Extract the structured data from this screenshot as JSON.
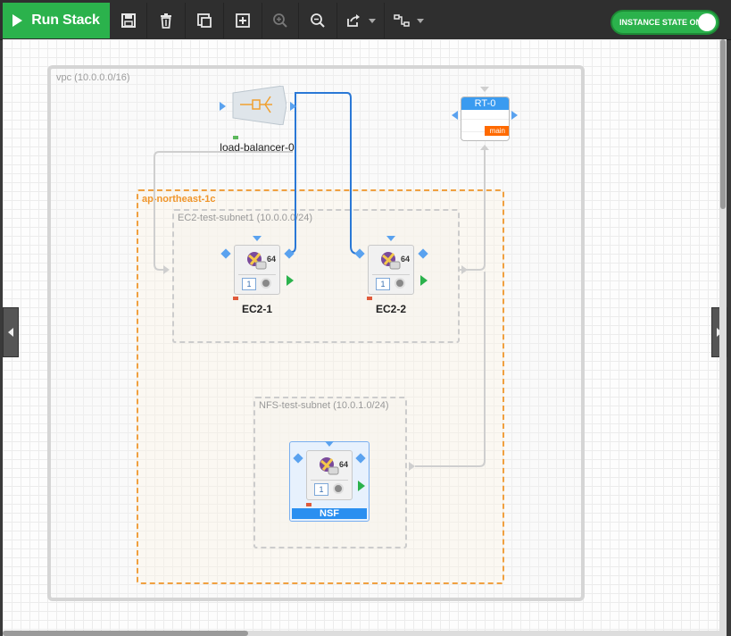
{
  "toolbar": {
    "run_label": "Run Stack",
    "instance_state_label": "INSTANCE STATE ON",
    "icons": [
      "save-icon",
      "trash-icon",
      "duplicate-icon",
      "add-icon",
      "zoom-in-icon",
      "zoom-out-icon",
      "export-icon",
      "link-mode-icon"
    ]
  },
  "canvas": {
    "vpc": {
      "label": "vpc (10.0.0.0/16)"
    },
    "az": {
      "label": "ap-northeast-1c"
    },
    "subnets": [
      {
        "label": "EC2-test-subnet1 (10.0.0.0/24)"
      },
      {
        "label": "NFS-test-subnet (10.0.1.0/24)"
      }
    ],
    "load_balancer": {
      "name": "load-balancer-0"
    },
    "route_table": {
      "name": "RT-0",
      "badge": "main"
    },
    "instances": [
      {
        "name": "EC2-1",
        "arch": "64",
        "volumes": "1"
      },
      {
        "name": "EC2-2",
        "arch": "64",
        "volumes": "1"
      },
      {
        "name": "NSF",
        "arch": "64",
        "volumes": "1"
      }
    ]
  },
  "colors": {
    "run_button": "#2bb24c",
    "toggle_on": "#2bb24c",
    "az_border": "#f0a040",
    "connection": "#2a78d6",
    "route_table_header": "#3a9bf0",
    "main_badge": "#ff6a00"
  }
}
